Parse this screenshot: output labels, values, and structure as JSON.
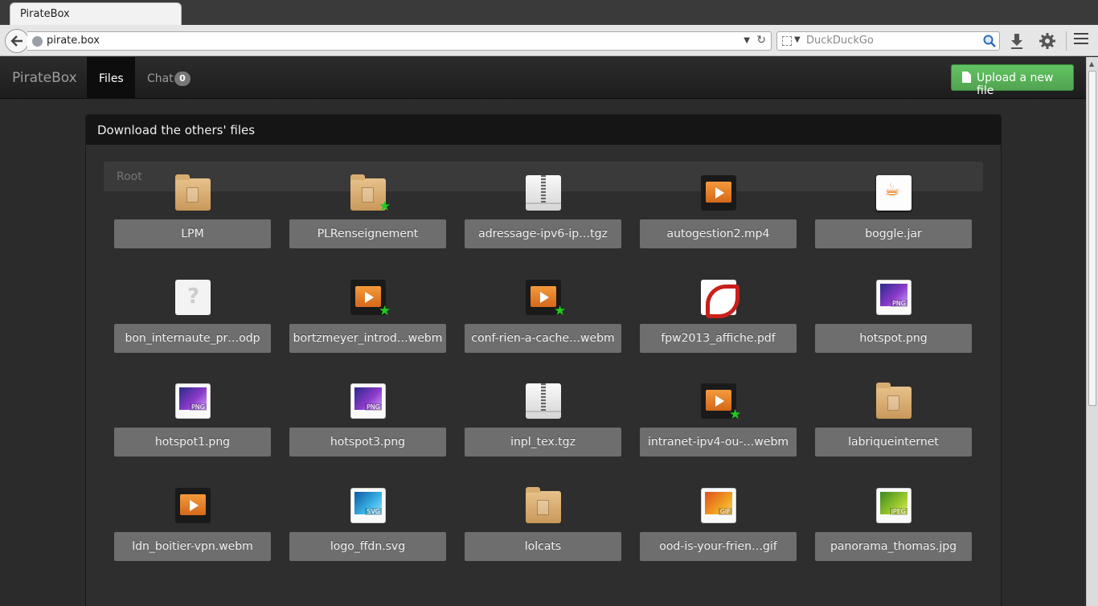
{
  "browser": {
    "tab_title": "PirateBox",
    "url": "pirate.box",
    "search_placeholder": "DuckDuckGo"
  },
  "nav": {
    "brand": "PirateBox",
    "files_label": "Files",
    "chat_label": "Chat",
    "chat_count": "0",
    "upload_label": "Upload a new file"
  },
  "panel": {
    "title": "Download the others' files",
    "breadcrumb_root": "Root"
  },
  "files": [
    {
      "label": "LPM",
      "icon": "folder-icon",
      "starred": false
    },
    {
      "label": "PLRenseignement",
      "icon": "folder-icon",
      "starred": true
    },
    {
      "label": "adressage-ipv6-ip…tgz",
      "icon": "archive-icon",
      "starred": false
    },
    {
      "label": "autogestion2.mp4",
      "icon": "video-icon",
      "starred": false
    },
    {
      "label": "boggle.jar",
      "icon": "java-icon",
      "starred": false
    },
    {
      "label": "bon_internaute_pr…odp",
      "icon": "unknown-file-icon",
      "starred": false
    },
    {
      "label": "bortzmeyer_introd…webm",
      "icon": "video-icon",
      "starred": true
    },
    {
      "label": "conf-rien-a-cache…webm",
      "icon": "video-icon",
      "starred": true
    },
    {
      "label": "fpw2013_affiche.pdf",
      "icon": "pdf-icon",
      "starred": false
    },
    {
      "label": "hotspot.png",
      "icon": "png-image-icon",
      "starred": false,
      "tag": "PNG"
    },
    {
      "label": "hotspot1.png",
      "icon": "png-image-icon",
      "starred": false,
      "tag": "PNG"
    },
    {
      "label": "hotspot3.png",
      "icon": "png-image-icon",
      "starred": false,
      "tag": "PNG"
    },
    {
      "label": "inpl_tex.tgz",
      "icon": "archive-icon",
      "starred": false
    },
    {
      "label": "intranet-ipv4-ou-…webm",
      "icon": "video-icon",
      "starred": true
    },
    {
      "label": "labriqueinternet",
      "icon": "folder-icon",
      "starred": false
    },
    {
      "label": "ldn_boitier-vpn.webm",
      "icon": "video-icon",
      "starred": false
    },
    {
      "label": "logo_ffdn.svg",
      "icon": "svg-image-icon",
      "starred": false,
      "tag": "SVG"
    },
    {
      "label": "lolcats",
      "icon": "folder-icon",
      "starred": false
    },
    {
      "label": "ood-is-your-frien…gif",
      "icon": "gif-image-icon",
      "starred": false,
      "tag": "GIF"
    },
    {
      "label": "panorama_thomas.jpg",
      "icon": "jpeg-image-icon",
      "starred": false,
      "tag": "JPEG"
    }
  ],
  "colors": {
    "accent_green": "#51a351",
    "star_green": "#1fcc1f",
    "label_bg": "#6e6e6e"
  }
}
